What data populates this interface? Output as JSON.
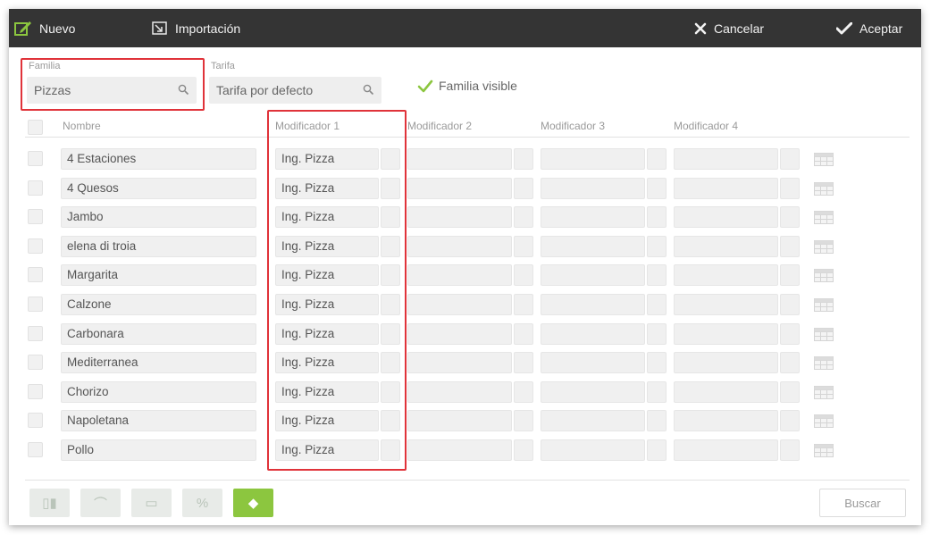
{
  "toolbar": {
    "nuevo": "Nuevo",
    "importacion": "Importación",
    "cancelar": "Cancelar",
    "aceptar": "Aceptar"
  },
  "filters": {
    "familia_label": "Familia",
    "familia_value": "Pizzas",
    "tarifa_label": "Tarifa",
    "tarifa_value": "Tarifa por defecto",
    "familia_visible_label": "Familia visible",
    "familia_visible_checked": true
  },
  "columns": [
    "Nombre",
    "Modificador 1",
    "Modificador 2",
    "Modificador 3",
    "Modificador 4"
  ],
  "rows": [
    {
      "nombre": "4 Estaciones",
      "mod1": "Ing. Pizza",
      "mod2": "",
      "mod3": "",
      "mod4": ""
    },
    {
      "nombre": "4 Quesos",
      "mod1": "Ing. Pizza",
      "mod2": "",
      "mod3": "",
      "mod4": ""
    },
    {
      "nombre": "Jambo",
      "mod1": "Ing. Pizza",
      "mod2": "",
      "mod3": "",
      "mod4": ""
    },
    {
      "nombre": "elena di troia",
      "mod1": "Ing. Pizza",
      "mod2": "",
      "mod3": "",
      "mod4": ""
    },
    {
      "nombre": "Margarita",
      "mod1": "Ing. Pizza",
      "mod2": "",
      "mod3": "",
      "mod4": ""
    },
    {
      "nombre": "Calzone",
      "mod1": "Ing. Pizza",
      "mod2": "",
      "mod3": "",
      "mod4": ""
    },
    {
      "nombre": "Carbonara",
      "mod1": "Ing. Pizza",
      "mod2": "",
      "mod3": "",
      "mod4": ""
    },
    {
      "nombre": "Mediterranea",
      "mod1": "Ing. Pizza",
      "mod2": "",
      "mod3": "",
      "mod4": ""
    },
    {
      "nombre": "Chorizo",
      "mod1": "Ing. Pizza",
      "mod2": "",
      "mod3": "",
      "mod4": ""
    },
    {
      "nombre": "Napoletana",
      "mod1": "Ing. Pizza",
      "mod2": "",
      "mod3": "",
      "mod4": ""
    },
    {
      "nombre": "Pollo",
      "mod1": "Ing. Pizza",
      "mod2": "",
      "mod3": "",
      "mod4": ""
    }
  ],
  "footer": {
    "buttons": [
      {
        "icon": "barcode-icon",
        "glyph": "▯▮"
      },
      {
        "icon": "chart-icon",
        "glyph": "⌒"
      },
      {
        "icon": "printer-icon",
        "glyph": "▭"
      },
      {
        "icon": "percent-icon",
        "glyph": "%"
      },
      {
        "icon": "eraser-icon",
        "glyph": "◆"
      }
    ],
    "buscar": "Buscar"
  },
  "colors": {
    "toolbar_bg": "#343434",
    "accent_green": "#8cc63f",
    "highlight_red": "#e0333a"
  }
}
